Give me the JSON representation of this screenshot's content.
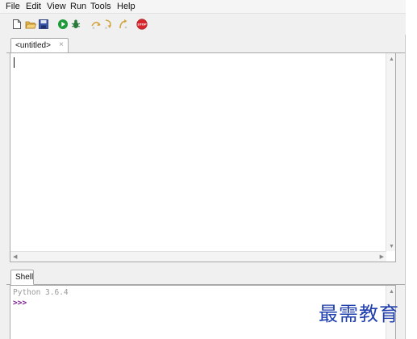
{
  "menu": {
    "items": [
      "File",
      "Edit",
      "View",
      "Run",
      "Tools",
      "Help"
    ]
  },
  "toolbar": {
    "icons": [
      "new-file-icon",
      "open-folder-icon",
      "save-icon",
      "run-icon",
      "debug-icon",
      "step-over-icon",
      "step-into-icon",
      "step-out-icon",
      "stop-icon"
    ],
    "stop_label": "STOP"
  },
  "editor": {
    "tab_label": "<untitled>",
    "tab_close": "×",
    "content": ""
  },
  "shell": {
    "tab_label": "Shell",
    "version_line": "Python 3.6.4",
    "prompt": ">>>"
  },
  "watermark": "最需教育",
  "colors": {
    "run_green": "#1f9a3a",
    "stop_red": "#d8252b",
    "prompt_purple": "#7b1d8f",
    "watermark_blue": "#1f3fae"
  }
}
